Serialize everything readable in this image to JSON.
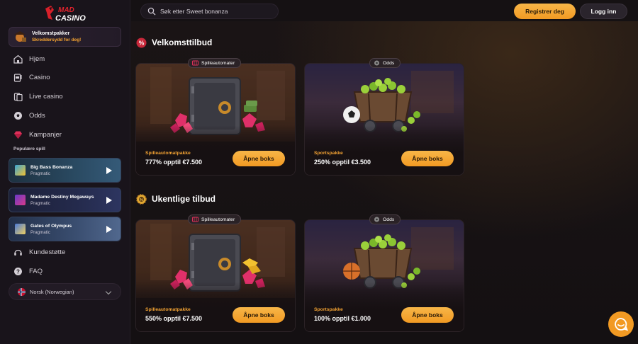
{
  "brand": {
    "line1": "MAD",
    "line2": "CASINO"
  },
  "header": {
    "search_placeholder": "Søk etter Sweet bonanza",
    "register_label": "Registrer deg",
    "login_label": "Logg inn"
  },
  "sidebar": {
    "welcome": {
      "title": "Velkomstpakker",
      "subtitle": "Skreddersydd for deg!"
    },
    "nav": [
      {
        "label": "Hjem",
        "icon": "home-icon"
      },
      {
        "label": "Casino",
        "icon": "slot-machine-icon"
      },
      {
        "label": "Live casino",
        "icon": "cards-icon"
      },
      {
        "label": "Odds",
        "icon": "football-icon"
      },
      {
        "label": "Kampanjer",
        "icon": "gem-icon"
      }
    ],
    "popular_label": "Populære spill",
    "games": [
      {
        "name": "Big Bass Bonanza",
        "provider": "Pragmatic"
      },
      {
        "name": "Madame Destiny Megaways",
        "provider": "Pragmatic"
      },
      {
        "name": "Gates of Olympus",
        "provider": "Pragmatic"
      }
    ],
    "support": [
      {
        "label": "Kundestøtte",
        "icon": "headset-icon"
      },
      {
        "label": "FAQ",
        "icon": "question-icon"
      }
    ],
    "language": "Norsk (Norwegian)"
  },
  "sections": [
    {
      "title": "Velkomsttilbud",
      "cards": [
        {
          "tag": "Spilleautomater",
          "type": "Spilleautomatpakke",
          "offer": "777% opptil €7.500",
          "button": "Åpne boks"
        },
        {
          "tag": "Odds",
          "type": "Sportspakke",
          "offer": "250% opptil €3.500",
          "button": "Åpne boks"
        }
      ]
    },
    {
      "title": "Ukentlige tilbud",
      "cards": [
        {
          "tag": "Spilleautomater",
          "type": "Spilleautomatpakke",
          "offer": "550% opptil €7.500",
          "button": "Åpne boks"
        },
        {
          "tag": "Odds",
          "type": "Sportspakke",
          "offer": "100% opptil €1.000",
          "button": "Åpne boks"
        }
      ]
    }
  ],
  "colors": {
    "accent": "#f29a23",
    "offer_label": "#f2a233",
    "background": "#151113"
  }
}
